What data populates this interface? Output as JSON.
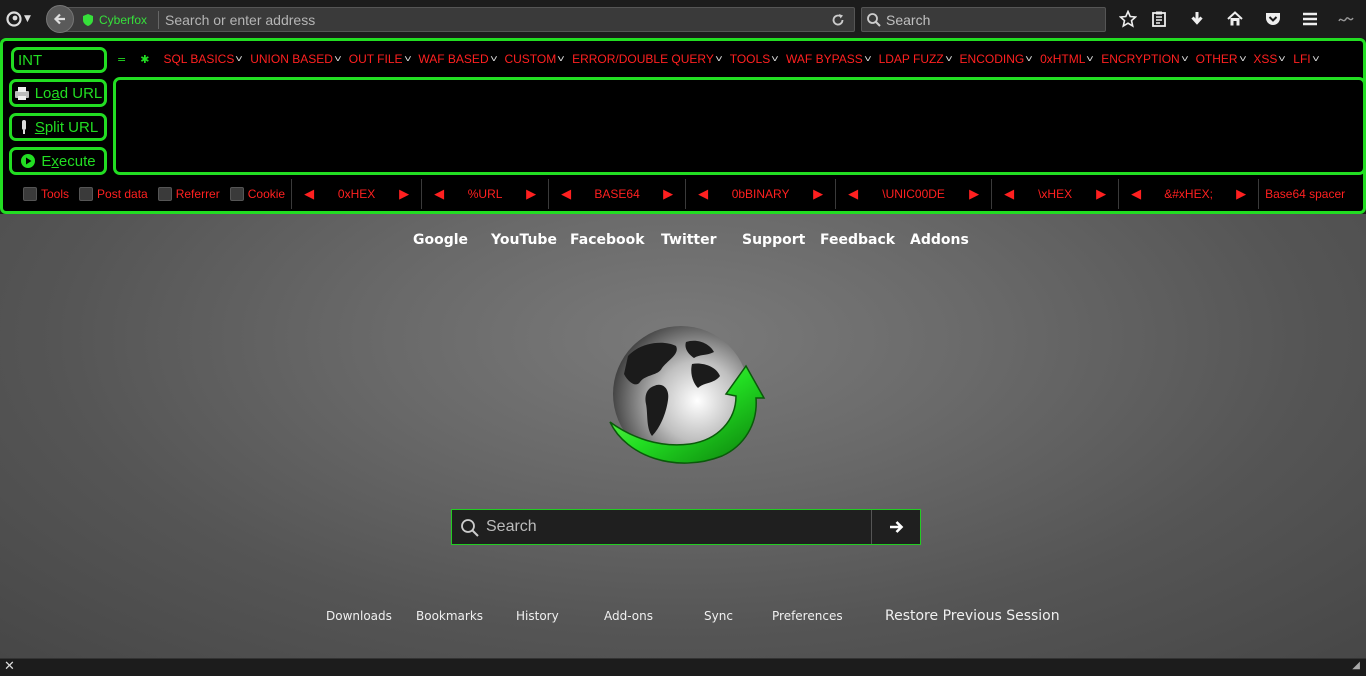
{
  "toolbar": {
    "url_identity": "Cyberfox",
    "url_placeholder": "Search or enter address",
    "search_placeholder": "Search"
  },
  "hackbar": {
    "int_value": "INT",
    "load_url": {
      "pre": "Lo",
      "ul": "a",
      "post": "d URL"
    },
    "split_url": {
      "pre": "",
      "ul": "S",
      "post": "plit URL"
    },
    "execute": {
      "pre": "E",
      "ul": "x",
      "post": "ecute"
    },
    "menu_markers": [
      "=",
      "✱"
    ],
    "menus": [
      "SQL BASICS",
      "UNION BASED",
      "OUT FILE",
      "WAF BASED",
      "CUSTOM",
      "ERROR/DOUBLE QUERY",
      "TOOLS",
      "WAF BYPASS",
      "LDAP FUZZ",
      "ENCODING",
      "0xHTML",
      "ENCRYPTION",
      "OTHER",
      "XSS",
      "LFI"
    ],
    "checkboxes": [
      "Tools",
      "Post data",
      "Referrer",
      "Cookie"
    ],
    "converters": [
      "0xHEX",
      "%URL",
      "BASE64",
      "0bBINARY",
      "\\UNIC00DE",
      "\\xHEX",
      "&#xHEX;"
    ],
    "spacer": "Base64 spacer"
  },
  "home": {
    "quicklinks": [
      "Google",
      "YouTube",
      "Facebook",
      "Twitter",
      "Support",
      "Feedback",
      "Addons"
    ],
    "search_placeholder": "Search",
    "bottom_links": [
      "Downloads",
      "Bookmarks",
      "History",
      "Add-ons",
      "Sync",
      "Preferences"
    ],
    "restore_session": "Restore Previous Session"
  },
  "colors": {
    "accent_green": "#22dd22",
    "menu_red": "#ff2020",
    "toolbar_bg": "#1c1c1c"
  }
}
